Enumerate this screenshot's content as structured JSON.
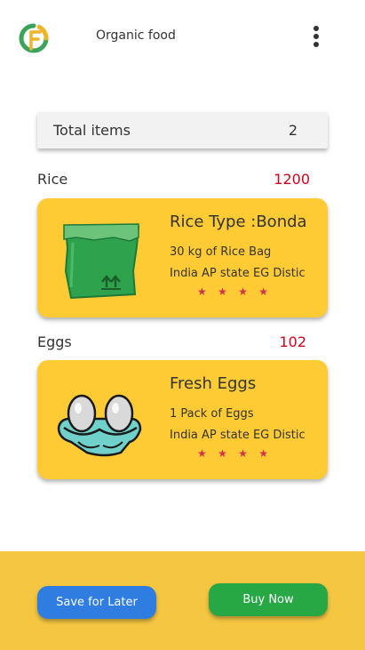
{
  "app": {
    "title": "Organic food"
  },
  "summary": {
    "label": "Total items",
    "value": "2"
  },
  "products": [
    {
      "section_label": "Rice",
      "price": "1200",
      "name": "Rice Type :Bonda",
      "description": "30 kg of Rice Bag",
      "origin": "India AP state EG Distic",
      "rating": 4,
      "image_icon": "rice-bag-icon"
    },
    {
      "section_label": "Eggs",
      "price": "102",
      "name": "Fresh Eggs",
      "description": "1 Pack of Eggs",
      "origin": "India AP state EG Distic",
      "rating": 4,
      "image_icon": "egg-tray-icon"
    }
  ],
  "actions": {
    "save_label": "Save for Later",
    "buy_label": "Buy Now"
  },
  "colors": {
    "card": "#ffcb35",
    "footer": "#f4c642",
    "price": "#d0021b",
    "save_button": "#2f7de1",
    "buy_button": "#28a745",
    "star": "#d1314b"
  }
}
